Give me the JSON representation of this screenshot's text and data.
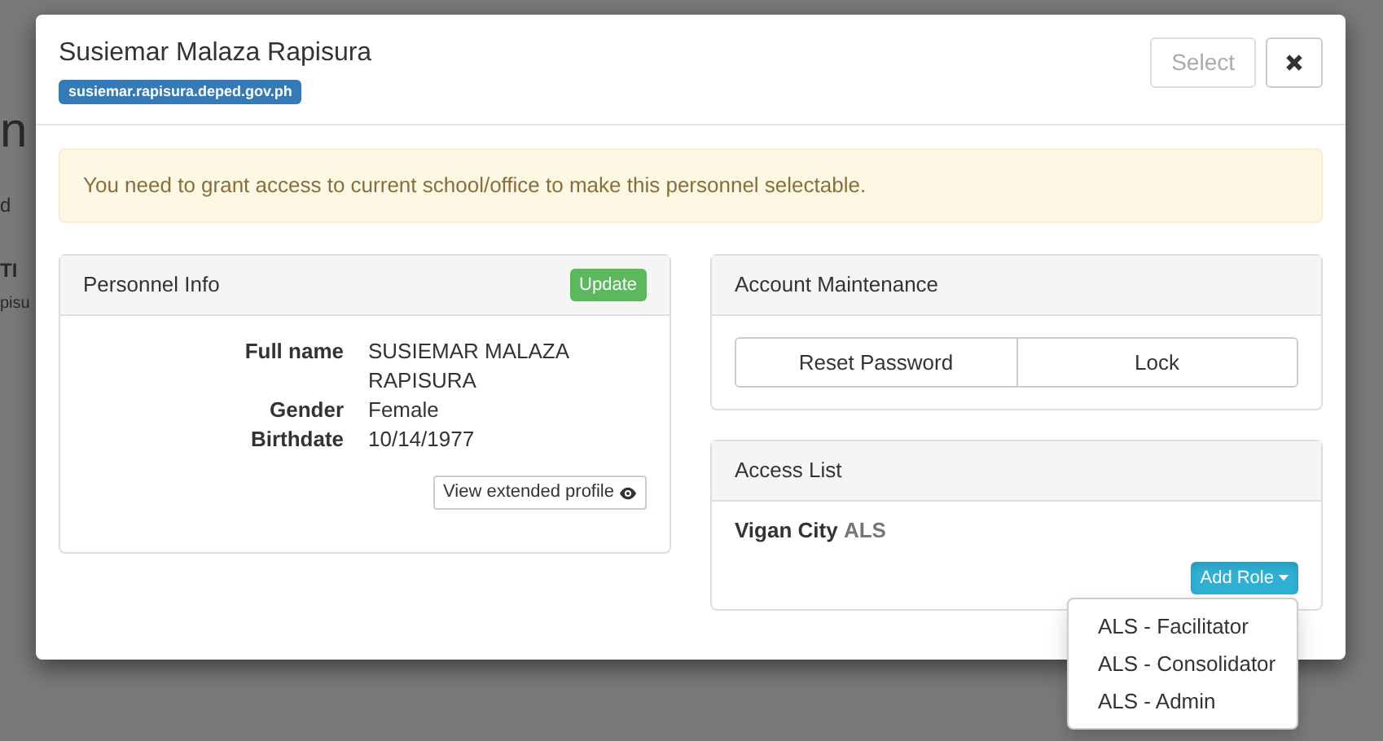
{
  "background_page": {
    "heading_fragment": "n",
    "text_fragments": [
      "d",
      "TI",
      "pisu"
    ]
  },
  "modal": {
    "title": "Susiemar Malaza Rapisura",
    "email_label": "susiemar.rapisura.deped.gov.ph",
    "select_button": {
      "label": "Select",
      "disabled": true
    },
    "alert": "You need to grant access to current school/office to make this personnel selectable.",
    "personnel_info": {
      "title": "Personnel Info",
      "update_button": "Update",
      "fields": [
        {
          "label": "Full name",
          "value": "SUSIEMAR MALAZA RAPISURA"
        },
        {
          "label": "Gender",
          "value": "Female"
        },
        {
          "label": "Birthdate",
          "value": "10/14/1977"
        }
      ],
      "extended_profile_button": "View extended profile"
    },
    "account_maintenance": {
      "title": "Account Maintenance",
      "buttons": [
        "Reset Password",
        "Lock"
      ]
    },
    "access_list": {
      "title": "Access List",
      "entries": [
        {
          "office": "Vigan City",
          "program": "ALS"
        }
      ],
      "add_role": {
        "label": "Add Role",
        "expanded": true,
        "options": [
          "ALS - Facilitator",
          "ALS - Consolidator",
          "ALS - Admin"
        ]
      }
    }
  }
}
